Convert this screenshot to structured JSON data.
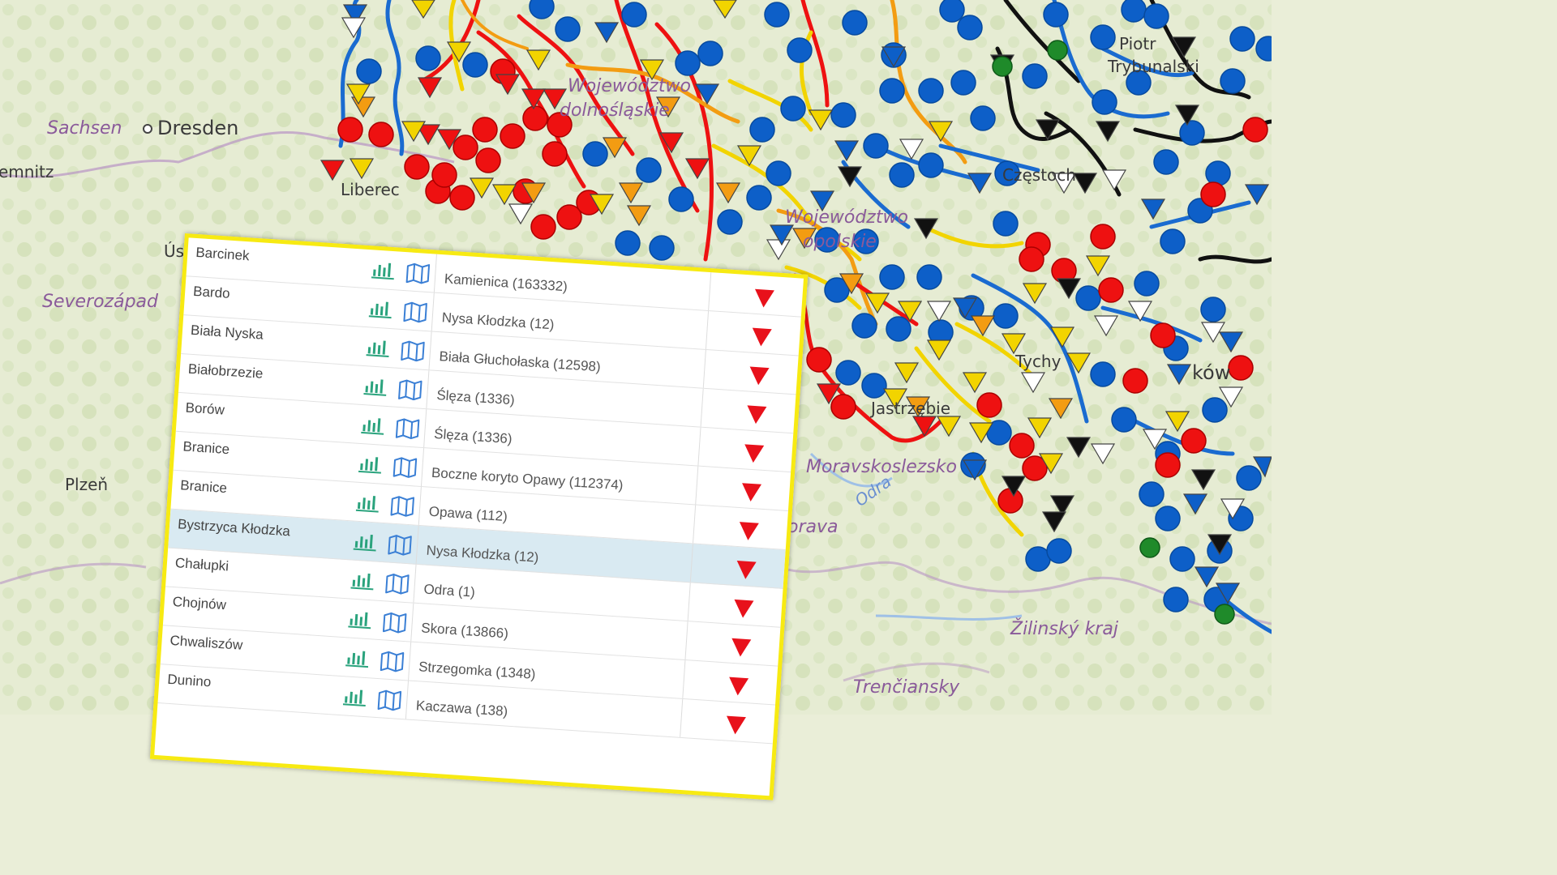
{
  "map": {
    "regions": [
      {
        "name": "Sachsen"
      },
      {
        "name": "Severozápad"
      },
      {
        "name": "Moravskoslezsko"
      },
      {
        "name": "Žilinský kraj"
      },
      {
        "name": "Trenčiansky"
      },
      {
        "name": "Morava"
      }
    ],
    "cities": [
      {
        "name": "Dresden"
      },
      {
        "name": "emnitz"
      },
      {
        "name": "Liberec"
      },
      {
        "name": "Plzeň"
      },
      {
        "name": "Ús"
      },
      {
        "name": "Częstoch"
      },
      {
        "name": "Piotr"
      },
      {
        "name": "Trybunalski"
      },
      {
        "name": "Tychy"
      },
      {
        "name": "Jastrzębie"
      },
      {
        "name": "ków"
      }
    ],
    "partial_labels": [
      {
        "text": "Województwo"
      },
      {
        "text": "dolnośląskie"
      },
      {
        "text": "Województwo"
      },
      {
        "text": "opolskie"
      },
      {
        "text": "Odra"
      }
    ],
    "marker_colors": {
      "ok": "#0d5fc8",
      "warning": "#f2d400",
      "alert": "#f39c12",
      "danger": "#ee1111",
      "low": "#111111",
      "none": "#ffffff",
      "green": "#1f8a2a"
    }
  },
  "table": {
    "rows": [
      {
        "station": "Barcinek",
        "river": "Kamienica (163332)",
        "status": "alert-state"
      },
      {
        "station": "Bardo",
        "river": "Nysa Kłodzka (12)",
        "status": "alert-state"
      },
      {
        "station": "Biała Nyska",
        "river": "Biała Głuchołaska (12598)",
        "status": "alert-state"
      },
      {
        "station": "Białobrzezie",
        "river": "Ślęza (1336)",
        "status": "alert-state"
      },
      {
        "station": "Borów",
        "river": "Ślęza (1336)",
        "status": "alert-state"
      },
      {
        "station": "Branice",
        "river": "Boczne koryto Opawy (112374)",
        "status": "alert-state"
      },
      {
        "station": "Branice",
        "river": "Opawa (112)",
        "status": "alert-state"
      },
      {
        "station": "Bystrzyca Kłodzka",
        "river": "Nysa Kłodzka (12)",
        "status": "alert-state",
        "selected": true
      },
      {
        "station": "Chałupki",
        "river": "Odra (1)",
        "status": "alert-state"
      },
      {
        "station": "Chojnów",
        "river": "Skora (13866)",
        "status": "alert-state"
      },
      {
        "station": "Chwaliszów",
        "river": "Strzegomka (1348)",
        "status": "alert-state"
      },
      {
        "station": "Dunino",
        "river": "Kaczawa (138)",
        "status": "alert-state"
      }
    ],
    "colors": {
      "accent": "#2aa37d",
      "map_icon": "#3a7fd5",
      "alert": "#e8111b",
      "border": "#f7ea12",
      "selected": "#d9eaf2"
    }
  }
}
